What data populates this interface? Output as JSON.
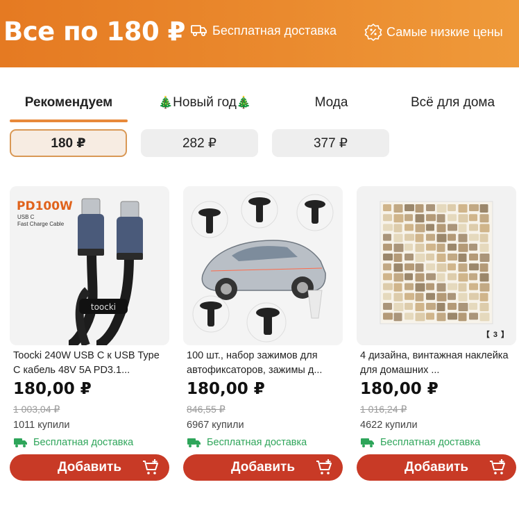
{
  "banner": {
    "title": "Все по 180 ₽",
    "feature1": "Бесплатная доставка",
    "feature1_icon": "truck-icon",
    "feature2": "Самые низкие цены",
    "feature2_icon": "discount-badge-icon",
    "color": "#e8832c"
  },
  "tabs": [
    {
      "label": "Рекомендуем",
      "active": true
    },
    {
      "label": "Новый год",
      "prefix_icon": "christmas-tree-icon",
      "suffix_icon": "christmas-tree-icon"
    },
    {
      "label": "Мода"
    },
    {
      "label": "Всё для дома"
    }
  ],
  "price_chips": [
    {
      "label": "180 ₽",
      "selected": true
    },
    {
      "label": "282 ₽"
    },
    {
      "label": "377 ₽"
    }
  ],
  "products": [
    {
      "image_text_main": "PD100W",
      "image_text_sub1": "USB C",
      "image_text_sub2": "Fast Charge Cable",
      "image_brand": "toocki",
      "title": "Toocki 240W USB C к USB Type C кабель 48V 5A PD3.1...",
      "price": "180,00 ₽",
      "old_price": "1 003,04 ₽",
      "sold": "1011 купили",
      "shipping": "Бесплатная доставка",
      "button": "Добавить"
    },
    {
      "title": "100 шт., набор зажимов для автофиксаторов, зажимы д...",
      "price": "180,00 ₽",
      "old_price": "846,55 ₽",
      "sold": "6967 купили",
      "shipping": "Бесплатная доставка",
      "button": "Добавить"
    },
    {
      "title": "4 дизайна, винтажная наклейка для домашних ...",
      "price": "180,00 ₽",
      "old_price": "1 016,24 ₽",
      "sold": "4622 купили",
      "shipping": "Бесплатная доставка",
      "button": "Добавить",
      "image_pager": "【 3 】"
    }
  ],
  "colors": {
    "accent": "#e8893a",
    "button": "#c83a26",
    "shipping": "#2ea55a"
  }
}
